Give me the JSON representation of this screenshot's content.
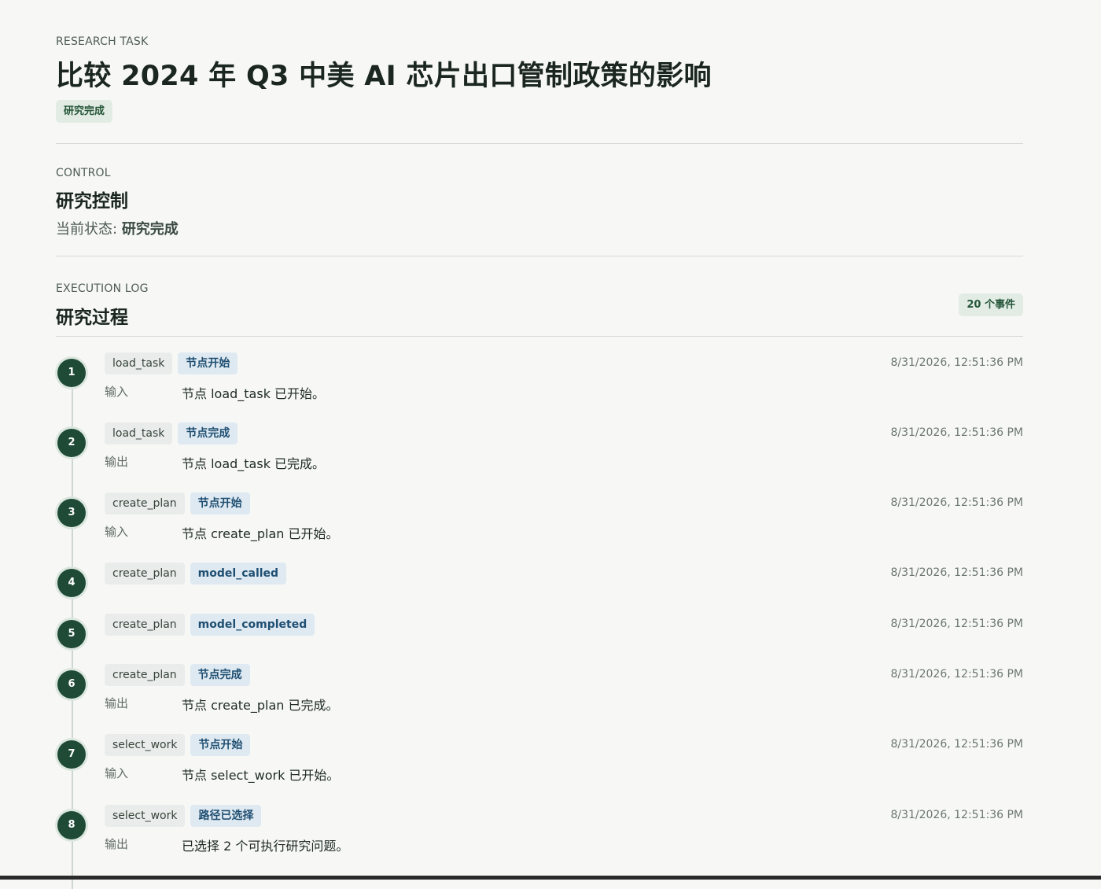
{
  "task": {
    "eyebrow": "RESEARCH TASK",
    "title": "比较 2024 年 Q3 中美 AI 芯片出口管制政策的影响",
    "status": "研究完成"
  },
  "control": {
    "eyebrow": "CONTROL",
    "title": "研究控制",
    "state_label": "当前状态:",
    "state_value": "研究完成"
  },
  "log": {
    "eyebrow": "EXECUTION LOG",
    "title": "研究过程",
    "count": "20 个事件",
    "events": [
      {
        "step": "1",
        "node": "load_task",
        "type": "节点开始",
        "time": "8/31/2026, 12:51:36 PM",
        "io_label": "输入",
        "io_text": "节点 load_task 已开始。"
      },
      {
        "step": "2",
        "node": "load_task",
        "type": "节点完成",
        "time": "8/31/2026, 12:51:36 PM",
        "io_label": "输出",
        "io_text": "节点 load_task 已完成。"
      },
      {
        "step": "3",
        "node": "create_plan",
        "type": "节点开始",
        "time": "8/31/2026, 12:51:36 PM",
        "io_label": "输入",
        "io_text": "节点 create_plan 已开始。"
      },
      {
        "step": "4",
        "node": "create_plan",
        "type": "model_called",
        "time": "8/31/2026, 12:51:36 PM",
        "io_label": "",
        "io_text": ""
      },
      {
        "step": "5",
        "node": "create_plan",
        "type": "model_completed",
        "time": "8/31/2026, 12:51:36 PM",
        "io_label": "",
        "io_text": ""
      },
      {
        "step": "6",
        "node": "create_plan",
        "type": "节点完成",
        "time": "8/31/2026, 12:51:36 PM",
        "io_label": "输出",
        "io_text": "节点 create_plan 已完成。"
      },
      {
        "step": "7",
        "node": "select_work",
        "type": "节点开始",
        "time": "8/31/2026, 12:51:36 PM",
        "io_label": "输入",
        "io_text": "节点 select_work 已开始。"
      },
      {
        "step": "8",
        "node": "select_work",
        "type": "路径已选择",
        "time": "8/31/2026, 12:51:36 PM",
        "io_label": "输出",
        "io_text": "已选择 2 个可执行研究问题。"
      }
    ]
  }
}
